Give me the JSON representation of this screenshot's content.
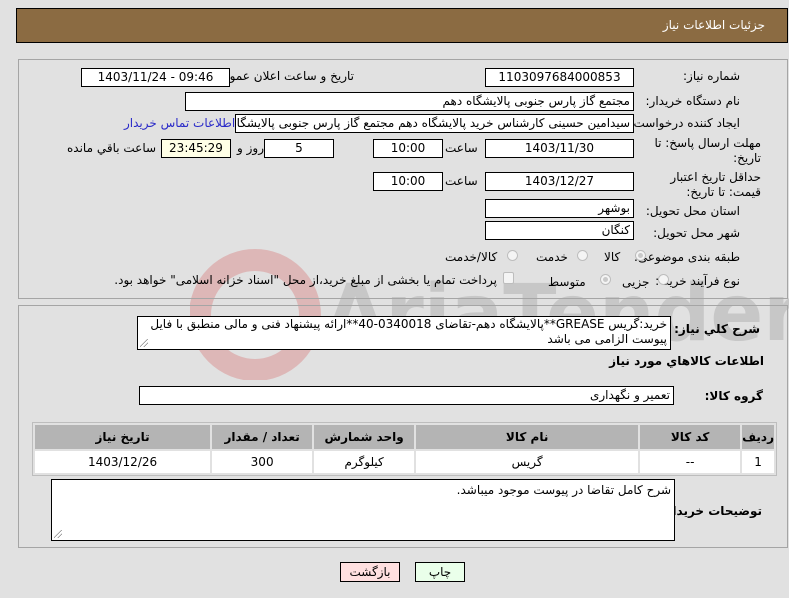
{
  "header": {
    "title": "جزئيات اطلاعات نياز"
  },
  "form": {
    "need_number_label": "شماره نیاز:",
    "need_number": "1103097684000853",
    "announce_label": "تاريخ و ساعت اعلان عمومي:",
    "announce_value": "1403/11/24 - 09:46",
    "buyer_org_label": "نام دستگاه خریدار:",
    "buyer_org": "مجتمع گاز پارس جنوبی  پالایشگاه دهم",
    "creator_label": "ایجاد کننده درخواست:",
    "creator": "سیدامین حسینی کارشناس خرید پالایشگاه دهم  مجتمع گاز پارس جنوبی  پالایشگاه دهم",
    "contact_link": "اطلاعات تماس خریدار",
    "reply_deadline_label": "مهلت ارسال پاسخ: تا تاریخ:",
    "reply_date": "1403/11/30",
    "time_label": "ساعت",
    "reply_time": "10:00",
    "days_value": "5",
    "days_label": "روز و",
    "remaining_time": "23:45:29",
    "remaining_label": "ساعت باقي مانده",
    "price_validity_label": "حداقل تاریخ اعتبار قیمت: تا تاریخ:",
    "price_date": "1403/12/27",
    "price_time": "10:00",
    "province_label": "استان محل تحویل:",
    "province": "بوشهر",
    "city_label": "شهر محل تحویل:",
    "city": "کنگان",
    "category_label": "طبقه بندی موضوعی:",
    "category_options": [
      "کالا",
      "خدمت",
      "کالا/خدمت"
    ],
    "category_selected": "کالا",
    "process_label": "نوع فرآیند خرید :",
    "process_options": [
      "جزیی",
      "متوسط"
    ],
    "process_selected": "متوسط",
    "treasury_text": "پرداخت تمام یا بخشی از مبلغ خرید،از محل \"اسناد خزانه اسلامی\" خواهد بود."
  },
  "description": {
    "label": "شرح کلي نياز:",
    "text": "خرید:گریس GREASE**پالایشگاه دهم-تقاضای 0340018-40**ارائه پیشنهاد فنی و مالی منطبق با فایل پیوست الزامی می باشد"
  },
  "goods": {
    "section_title": "اطلاعات کالاهاي مورد نياز",
    "group_label": "گروه کالا:",
    "group_value": "تعمیر و نگهداری",
    "columns": [
      "ردیف",
      "کد کالا",
      "نام کالا",
      "واحد شمارش",
      "تعداد / مقدار",
      "تاریخ نیاز"
    ],
    "rows": [
      {
        "row": "1",
        "code": "--",
        "name": "گریس",
        "unit": "کیلوگرم",
        "qty": "300",
        "date": "1403/12/26"
      }
    ]
  },
  "buyer_notes": {
    "label": "توضیحات خریدار:",
    "text": "شرح کامل تقاضا در پیوست موجود میباشد."
  },
  "buttons": {
    "print": "چاپ",
    "back": "بازگشت"
  },
  "colors": {
    "header": "#8b6b42",
    "print_bg": "#eaffea",
    "back_bg": "#ffe0e0",
    "link": "#2a2ac8"
  }
}
